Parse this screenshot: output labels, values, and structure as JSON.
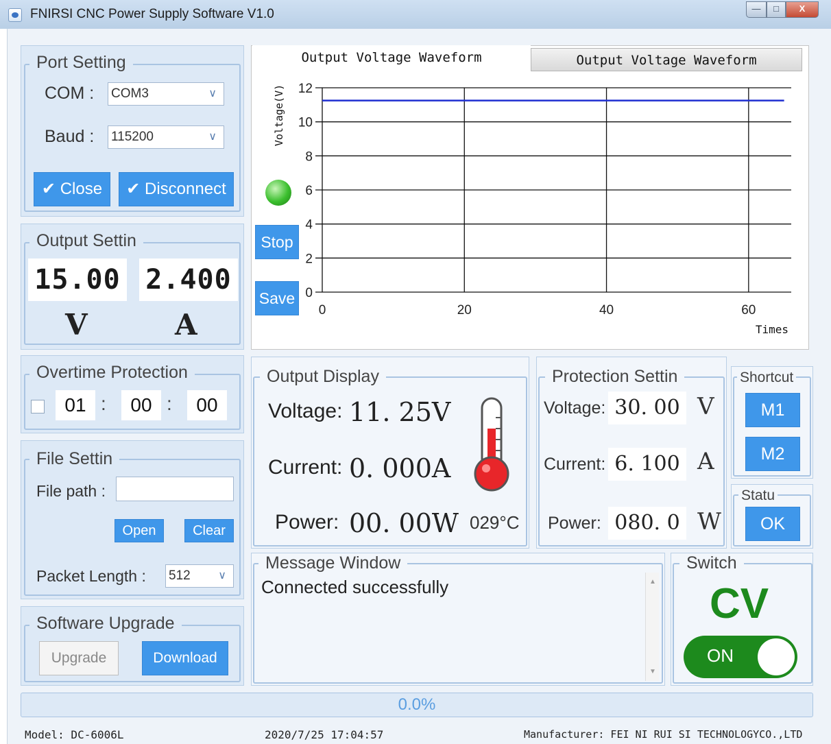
{
  "window": {
    "title": "FNIRSI CNC Power Supply Software V1.0",
    "min_glyph": "—",
    "max_glyph": "□",
    "close_glyph": "X"
  },
  "port_setting": {
    "title": "Port Setting",
    "com_label": "COM :",
    "com_value": "COM3",
    "baud_label": "Baud :",
    "baud_value": "115200",
    "close_button": "Close",
    "disconnect_button": "Disconnect"
  },
  "output_setting": {
    "title": "Output Settin",
    "voltage": "15.00",
    "current": "2.400",
    "voltage_unit": "V",
    "current_unit": "A"
  },
  "overtime_protection": {
    "title": "Overtime Protection",
    "enabled": false,
    "hours": "01",
    "minutes": "00",
    "seconds": "00",
    "separator": ":"
  },
  "file_setting": {
    "title": "File Settin",
    "path_label": "File path :",
    "path_value": "",
    "open_button": "Open",
    "clear_button": "Clear",
    "packet_label": "Packet Length :",
    "packet_value": "512"
  },
  "software_upgrade": {
    "title": "Software Upgrade",
    "upgrade_button": "Upgrade",
    "download_button": "Download"
  },
  "chart_tabs": [
    "Output Voltage Waveform",
    "Output Voltage Waveform"
  ],
  "chart_controls": {
    "stop_button": "Stop",
    "save_button": "Save",
    "indicator_color": "#3bbf2e"
  },
  "chart_data": {
    "type": "line",
    "ylabel": "Voltage(V)",
    "xlabel": "Times",
    "xlim": [
      0,
      66
    ],
    "ylim": [
      0,
      12
    ],
    "x_ticks": [
      0,
      20,
      40,
      60
    ],
    "y_ticks": [
      0,
      2,
      4,
      6,
      8,
      10,
      12
    ],
    "grid": true,
    "series": [
      {
        "color": "#1f2fd1",
        "x": [
          0,
          10,
          20,
          30,
          40,
          50,
          60,
          65
        ],
        "y": [
          11.25,
          11.25,
          11.25,
          11.25,
          11.25,
          11.25,
          11.25,
          11.25
        ]
      }
    ]
  },
  "output_display": {
    "title": "Output Display",
    "voltage_label": "Voltage:",
    "voltage_value": "11. 25V",
    "current_label": "Current:",
    "current_value": "0. 000A",
    "power_label": "Power:",
    "power_value": "00. 00W",
    "temperature": "029°C"
  },
  "protection_setting": {
    "title": "Protection Settin",
    "voltage_label": "Voltage:",
    "voltage_value": "30. 00",
    "voltage_unit": "V",
    "current_label": "Current:",
    "current_value": "6. 100",
    "current_unit": "A",
    "power_label": "Power:",
    "power_value": "080. 0",
    "power_unit": "W"
  },
  "shortcut": {
    "title": "Shortcut",
    "m1": "M1",
    "m2": "M2"
  },
  "status": {
    "title": "Statu",
    "value": "OK"
  },
  "message_window": {
    "title": "Message Window",
    "message": "Connected successfully"
  },
  "switch": {
    "title": "Switch",
    "mode": "CV",
    "state": "ON",
    "color": "#1d8a1d"
  },
  "progress": {
    "text": "0.0%",
    "value": 0
  },
  "statusbar": {
    "model": "Model: DC-6006L",
    "datetime": "2020/7/25 17:04:57",
    "manufacturer": "Manufacturer: FEI NI RUI SI TECHNOLOGYCO.,LTD"
  }
}
